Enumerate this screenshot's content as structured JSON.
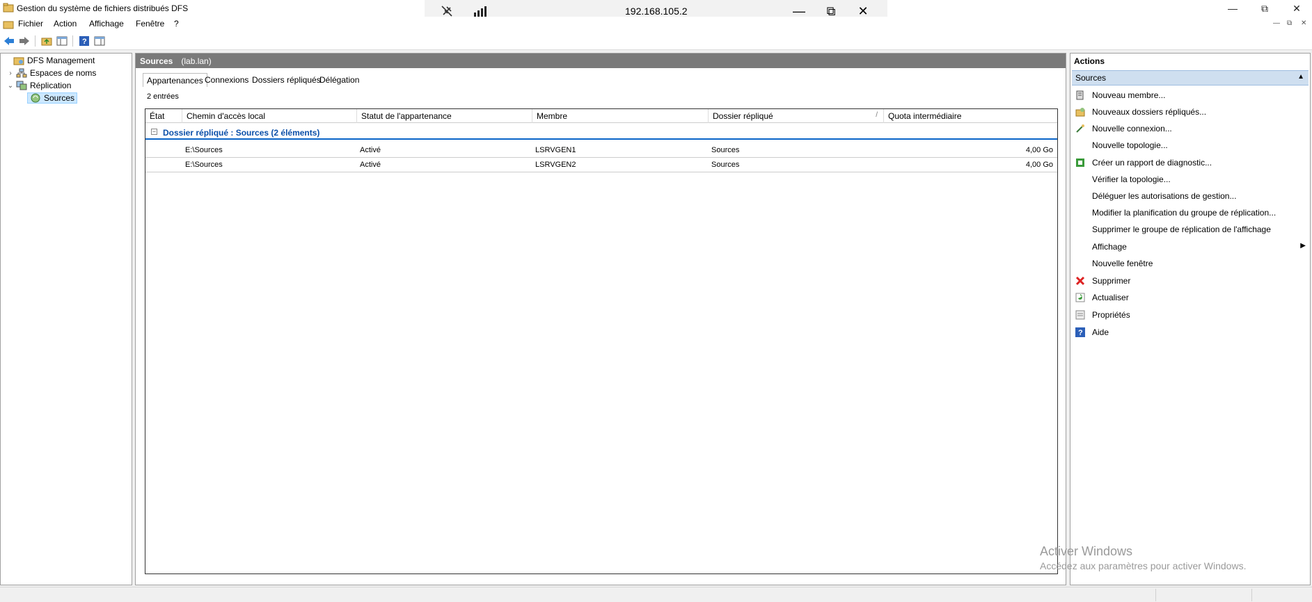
{
  "window": {
    "title": "Gestion du système de fichiers distribués DFS"
  },
  "rdp": {
    "ip": "192.168.105.2"
  },
  "menu": [
    "Fichier",
    "Action",
    "Affichage",
    "Fenêtre",
    "?"
  ],
  "tree": {
    "root": "DFS Management",
    "namespaces": "Espaces de noms",
    "replication": "Réplication",
    "sources": "Sources"
  },
  "center": {
    "title": "Sources",
    "subtitle": "(lab.lan)",
    "tabs": [
      "Appartenances",
      "Connexions",
      "Dossiers répliqués",
      "Délégation"
    ],
    "entries": "2 entrées",
    "columns": [
      "État",
      "Chemin d'accès local",
      "Statut de l'appartenance",
      "Membre",
      "Dossier répliqué",
      "Quota intermédiaire"
    ],
    "group_label": "Dossier répliqué : Sources (2 éléments)",
    "rows": [
      {
        "path": "E:\\Sources",
        "status": "Activé",
        "member": "LSRVGEN1",
        "folder": "Sources",
        "quota": "4,00 Go"
      },
      {
        "path": "E:\\Sources",
        "status": "Activé",
        "member": "LSRVGEN2",
        "folder": "Sources",
        "quota": "4,00 Go"
      }
    ]
  },
  "actions": {
    "title": "Actions",
    "section": "Sources",
    "items": [
      "Nouveau membre...",
      "Nouveaux dossiers répliqués...",
      "Nouvelle connexion...",
      "Nouvelle topologie...",
      "Créer un rapport de diagnostic...",
      "Vérifier la topologie...",
      "Déléguer les autorisations de gestion...",
      "Modifier la planification du groupe de réplication...",
      "Supprimer le groupe de réplication de l'affichage",
      "Affichage",
      "Nouvelle fenêtre",
      "Supprimer",
      "Actualiser",
      "Propriétés",
      "Aide"
    ]
  },
  "watermark": {
    "line1": "Activer Windows",
    "line2": "Accédez aux paramètres pour activer Windows."
  },
  "colors": {
    "selection": "#cce8ff",
    "group_accent": "#0a64c8",
    "actions_header": "#cfdff0",
    "panel_header": "#7a7a7a"
  }
}
